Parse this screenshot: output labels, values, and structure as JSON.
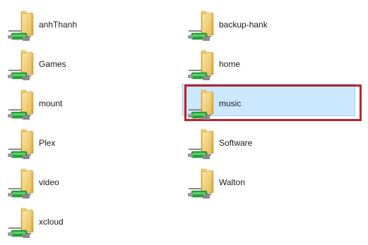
{
  "items": [
    {
      "label": "anhThanh",
      "selected": false
    },
    {
      "label": "backup-hank",
      "selected": false
    },
    {
      "label": "Games",
      "selected": false
    },
    {
      "label": "home",
      "selected": false
    },
    {
      "label": "mount",
      "selected": false
    },
    {
      "label": "music",
      "selected": true
    },
    {
      "label": "Plex",
      "selected": false
    },
    {
      "label": "Software",
      "selected": false
    },
    {
      "label": "video",
      "selected": false
    },
    {
      "label": "Walton",
      "selected": false
    },
    {
      "label": "xcloud",
      "selected": false
    }
  ],
  "icon": "network-share-folder-icon",
  "colors": {
    "selection_fill": "#cce8ff",
    "selection_border": "#99d1ff",
    "highlight_border": "#b8242f",
    "folder_light": "#f8df8b",
    "folder_dark": "#e7b954",
    "network_green": "#25a53a"
  }
}
